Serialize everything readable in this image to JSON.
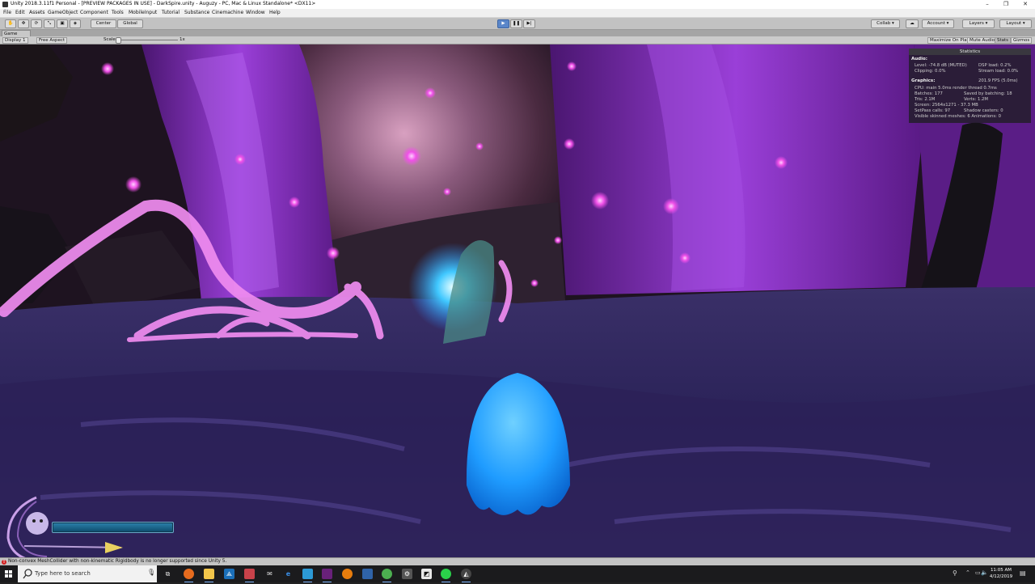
{
  "window": {
    "title": "Unity 2018.3.11f1 Personal - [PREVIEW PACKAGES IN USE] - DarkSpire.unity - Auguzy - PC, Mac & Linux Standalone* <DX11>",
    "minimize": "–",
    "restore": "❐",
    "close": "✕"
  },
  "menu": [
    "File",
    "Edit",
    "Assets",
    "GameObject",
    "Component",
    "Tools",
    "MobileInput",
    "Tutorial",
    "Substance",
    "Cinemachine",
    "Window",
    "Help"
  ],
  "toolbar": {
    "pivot": "Center",
    "space": "Global",
    "collab": "Collab ▾",
    "account": "Account ▾",
    "layers": "Layers ▾",
    "layout": "Layout ▾",
    "colors": {
      "play_active": "#5a86c9"
    }
  },
  "game_tab": {
    "label": "Game"
  },
  "game_view": {
    "display": "Display 1",
    "aspect": "Free Aspect",
    "scale_label": "Scale",
    "scale_value": "1x",
    "maximize": "Maximize On Play",
    "mute": "Mute Audio",
    "stats": "Stats",
    "gizmos": "Gizmos"
  },
  "stats": {
    "title": "Statistics",
    "audio_header": "Audio:",
    "level": "Level: -74.8 dB (MUTED)",
    "dsp": "DSP load: 0.2%",
    "clipping": "Clipping: 0.0%",
    "stream": "Stream load: 0.0%",
    "graphics_header": "Graphics:",
    "fps": "201.9 FPS (5.0ms)",
    "cpu": "CPU: main 5.0ms  render thread 0.7ms",
    "batches": "Batches: 177",
    "saved": "Saved by batching: 18",
    "tris": "Tris: 2.1M",
    "verts": "Verts: 1.2M",
    "screen": "Screen: 2564x1271 - 37.3 MB",
    "setpass": "SetPass calls: 97",
    "shadow": "Shadow casters: 0",
    "skinned": "Visible skinned meshes: 6  Animations: 0"
  },
  "hud": {
    "health_fraction": 1.0
  },
  "console": {
    "message": "Non-convex MeshCollider with non-kinematic Rigidbody is no longer supported since Unity 5."
  },
  "taskbar": {
    "search_placeholder": "Type here to search",
    "time": "11:05 AM",
    "date": "4/12/2019",
    "icons": [
      "task-view-icon",
      "firefox-icon",
      "file-explorer-icon",
      "network-icon",
      "mail-icon",
      "photos-icon",
      "edge-icon",
      "store-icon",
      "sourcetree-icon",
      "visual-studio-icon",
      "blender-icon",
      "chrome-icon",
      "settings-icon",
      "unity-hub-icon",
      "green-app-icon",
      "unity-icon"
    ]
  },
  "scene": {
    "colors": {
      "crystal": "#8a2fc7",
      "glow_root": "#f08cf0",
      "ghost": "#2ea8ff",
      "ground": "#2b2050"
    }
  }
}
